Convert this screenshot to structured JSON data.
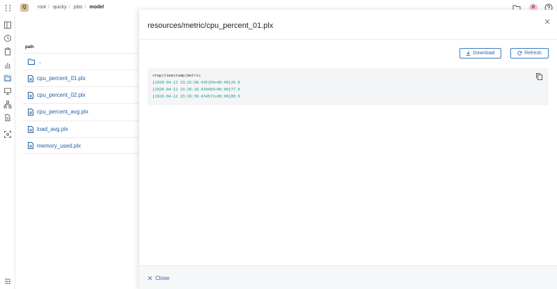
{
  "topbar": {
    "logo": "Q",
    "breadcrumb": [
      "root",
      "quicky",
      "jobs",
      "model"
    ],
    "avatar": "R"
  },
  "list": {
    "header": "path",
    "parent": "..",
    "items": [
      "cpu_percent_01.plx",
      "cpu_percent_02.plx",
      "cpu_percent_avg.plx",
      "load_avg.plx",
      "memory_used.plx"
    ]
  },
  "panel": {
    "title": "resources/metric/cpu_percent_01.plx",
    "download_label": "Download",
    "refresh_label": "Refresh",
    "close_label": "Close",
    "file_header": "step|timestamp|metric",
    "rows": [
      {
        "step": "",
        "timestamp": "2020-04-12 23:25:58.435294+00:00",
        "metric": "26.6"
      },
      {
        "step": "",
        "timestamp": "2020-04-12 23:26:18.434483+00:00",
        "metric": "77.0"
      },
      {
        "step": "",
        "timestamp": "2020-04-12 23:26:38.434572+00:00",
        "metric": "80.0"
      }
    ]
  },
  "colors": {
    "accent": "#2d67a8",
    "code_value": "#1e9a86",
    "logo_bg": "#d9c39a"
  }
}
